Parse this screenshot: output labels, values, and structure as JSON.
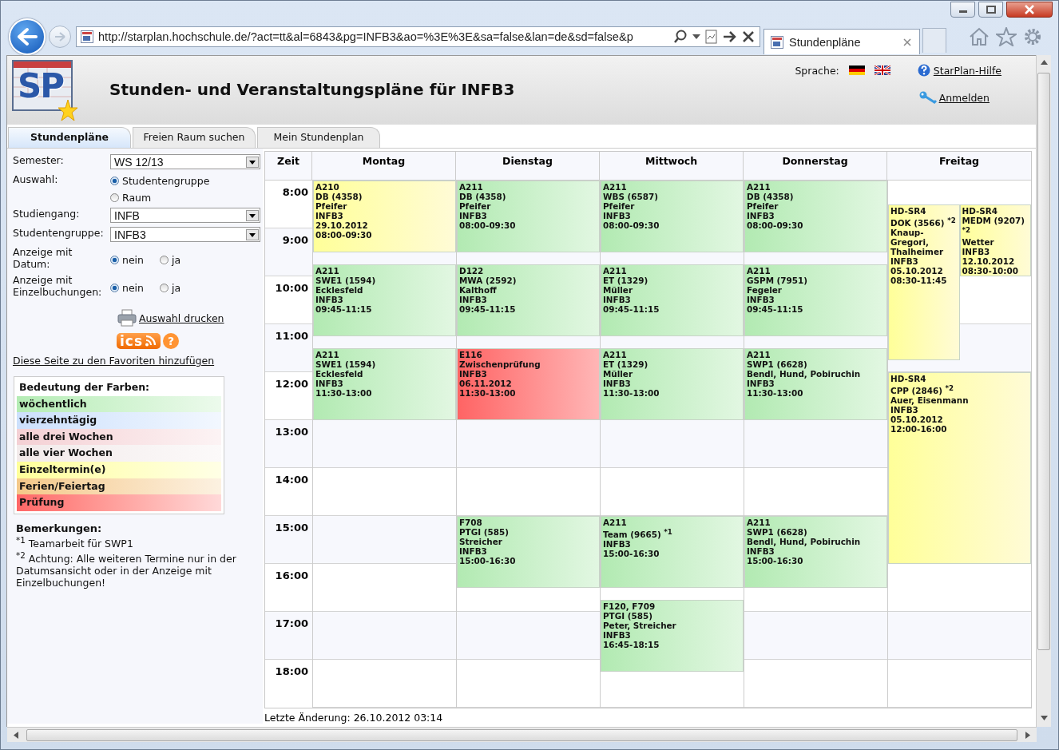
{
  "browser": {
    "url": "http://starplan.hochschule.de/?act=tt&al=6843&pg=INFB3&ao=%3E%3E&sa=false&lan=de&sd=false&p",
    "tab_title": "Stundenpläne"
  },
  "header": {
    "logo": "SP",
    "title": "Stunden- und Veranstaltungspläne für INFB3",
    "language_label": "Sprache:",
    "help_link": "StarPlan-Hilfe",
    "login_link": "Anmelden"
  },
  "tabs": [
    {
      "label": "Stundenpläne",
      "selected": true
    },
    {
      "label": "Freien Raum suchen",
      "selected": false
    },
    {
      "label": "Mein Stundenplan",
      "selected": false
    }
  ],
  "form": [
    {
      "kind": "select",
      "label": "Semester:",
      "value": "WS 12/13"
    },
    {
      "kind": "radio-stack",
      "label": "Auswahl:",
      "options": [
        {
          "label": "Studentengruppe",
          "selected": true
        },
        {
          "label": "Raum",
          "selected": false
        }
      ]
    },
    {
      "kind": "select",
      "label": "Studiengang:",
      "value": "INFB"
    },
    {
      "kind": "select",
      "label": "Studentengruppe:",
      "value": "INFB3"
    },
    {
      "kind": "radio-row",
      "label": "Anzeige mit Datum:",
      "options": [
        {
          "label": "nein",
          "selected": true
        },
        {
          "label": "ja",
          "selected": false
        }
      ]
    },
    {
      "kind": "radio-row",
      "label": "Anzeige mit Einzelbuchungen:",
      "options": [
        {
          "label": "nein",
          "selected": true
        },
        {
          "label": "ja",
          "selected": false
        }
      ]
    }
  ],
  "print_link": "Auswahl drucken",
  "ics": {
    "label": "ics",
    "help": "?"
  },
  "favorites_link": "Diese Seite zu den Favoriten hinzufügen",
  "legend": {
    "title": "Bedeutung der Farben:",
    "items": [
      {
        "label": "wöchentlich",
        "color": "#b4ecb4"
      },
      {
        "label": "vierzehntägig",
        "color": "#cce0fc"
      },
      {
        "label": "alle drei Wochen",
        "color": "#f4d0d4"
      },
      {
        "label": "alle vier Wochen",
        "color": "#f2eaea"
      },
      {
        "label": "Einzeltermin(e)",
        "color": "#ffff99"
      },
      {
        "label": "Ferien/Feiertag",
        "color": "#f4c888"
      },
      {
        "label": "Prüfung",
        "color": "#ff6666"
      }
    ]
  },
  "remarks": {
    "title": "Bemerkungen:",
    "items": [
      "$^{*1}$ Teamarbeit für SWP1",
      "$^{*2}$ Achtung: Alle weiteren Termine nur in der Datumsansicht oder in der Anzeige mit Einzelbuchungen!"
    ]
  },
  "timetable": {
    "time_header": "Zeit",
    "times": [
      "8:00",
      "9:00",
      "10:00",
      "11:00",
      "12:00",
      "13:00",
      "14:00",
      "15:00",
      "16:00",
      "17:00",
      "18:00"
    ],
    "days": [
      {
        "name": "Montag",
        "events": [
          {
            "kind": "single",
            "room": "A210",
            "course": "DB (4358)",
            "lecturer": "Pfeifer",
            "group": "INFB3",
            "date": "29.10.2012",
            "time": "08:00-09:30"
          },
          {
            "kind": "weekly",
            "room": "A211",
            "course": "SWE1 (1594)",
            "lecturer": "Ecklesfeld",
            "group": "INFB3",
            "time": "09:45-11:15"
          },
          {
            "kind": "weekly",
            "room": "A211",
            "course": "SWE1 (1594)",
            "lecturer": "Ecklesfeld",
            "group": "INFB3",
            "time": "11:30-13:00"
          }
        ]
      },
      {
        "name": "Dienstag",
        "events": [
          {
            "kind": "weekly",
            "room": "A211",
            "course": "DB (4358)",
            "lecturer": "Pfeifer",
            "group": "INFB3",
            "time": "08:00-09:30"
          },
          {
            "kind": "weekly",
            "room": "D122",
            "course": "MWA (2592)",
            "lecturer": "Kalthoff",
            "group": "INFB3",
            "time": "09:45-11:15"
          },
          {
            "kind": "exam",
            "room": "E116",
            "course": "Zwischenprüfung",
            "group": "INFB3",
            "date": "06.11.2012",
            "time": "11:30-13:00"
          },
          {
            "kind": "weekly",
            "room": "F708",
            "course": "PTGI (585)",
            "lecturer": "Streicher",
            "group": "INFB3",
            "time": "15:00-16:30"
          }
        ]
      },
      {
        "name": "Mittwoch",
        "events": [
          {
            "kind": "weekly",
            "room": "A211",
            "course": "WBS (6587)",
            "lecturer": "Pfeifer",
            "group": "INFB3",
            "time": "08:00-09:30"
          },
          {
            "kind": "weekly",
            "room": "A211",
            "course": "ET (1329)",
            "lecturer": "Müller",
            "group": "INFB3",
            "time": "09:45-11:15"
          },
          {
            "kind": "weekly",
            "room": "A211",
            "course": "ET (1329)",
            "lecturer": "Müller",
            "group": "INFB3",
            "time": "11:30-13:00"
          },
          {
            "kind": "weekly",
            "room": "A211",
            "course": "Team (9665) $^{*1}$",
            "group": "INFB3",
            "time": "15:00-16:30"
          },
          {
            "kind": "weekly",
            "room": "F120, F709",
            "course": "PTGI (585)",
            "lecturer": "Peter, Streicher",
            "group": "INFB3",
            "time": "16:45-18:15"
          }
        ]
      },
      {
        "name": "Donnerstag",
        "events": [
          {
            "kind": "weekly",
            "room": "A211",
            "course": "DB (4358)",
            "lecturer": "Pfeifer",
            "group": "INFB3",
            "time": "08:00-09:30"
          },
          {
            "kind": "weekly",
            "room": "A211",
            "course": "GSPM (7951)",
            "lecturer": "Fegeler",
            "group": "INFB3",
            "time": "09:45-11:15"
          },
          {
            "kind": "weekly",
            "room": "A211",
            "course": "SWP1 (6628)",
            "lecturer": "Bendl, Hund, Pobiruchin",
            "group": "INFB3",
            "time": "11:30-13:00"
          },
          {
            "kind": "weekly",
            "room": "A211",
            "course": "SWP1 (6628)",
            "lecturer": "Bendl, Hund, Pobiruchin",
            "group": "INFB3",
            "time": "15:00-16:30"
          }
        ]
      },
      {
        "name": "Freitag",
        "events": [
          {
            "kind": "single",
            "room": "HD-SR4",
            "course": "DOK (3566) $^{*2}$",
            "lecturer": "Knaup-Gregori, Thalheimer",
            "group": "INFB3",
            "date": "05.10.2012",
            "time": "08:30-11:45"
          },
          {
            "kind": "single",
            "room": "HD-SR4",
            "course": "MEDM (9207) $^{*2}$",
            "lecturer": "Wetter",
            "group": "INFB3",
            "date": "12.10.2012",
            "time": "08:30-10:00"
          },
          {
            "kind": "single",
            "room": "HD-SR4",
            "course": "CPP (2846) $^{*2}$",
            "lecturer": "Auer, Eisenmann",
            "group": "INFB3",
            "date": "05.10.2012",
            "time": "12:00-16:00"
          }
        ]
      }
    ]
  },
  "last_change": "Letzte Änderung: 26.10.2012 03:14"
}
